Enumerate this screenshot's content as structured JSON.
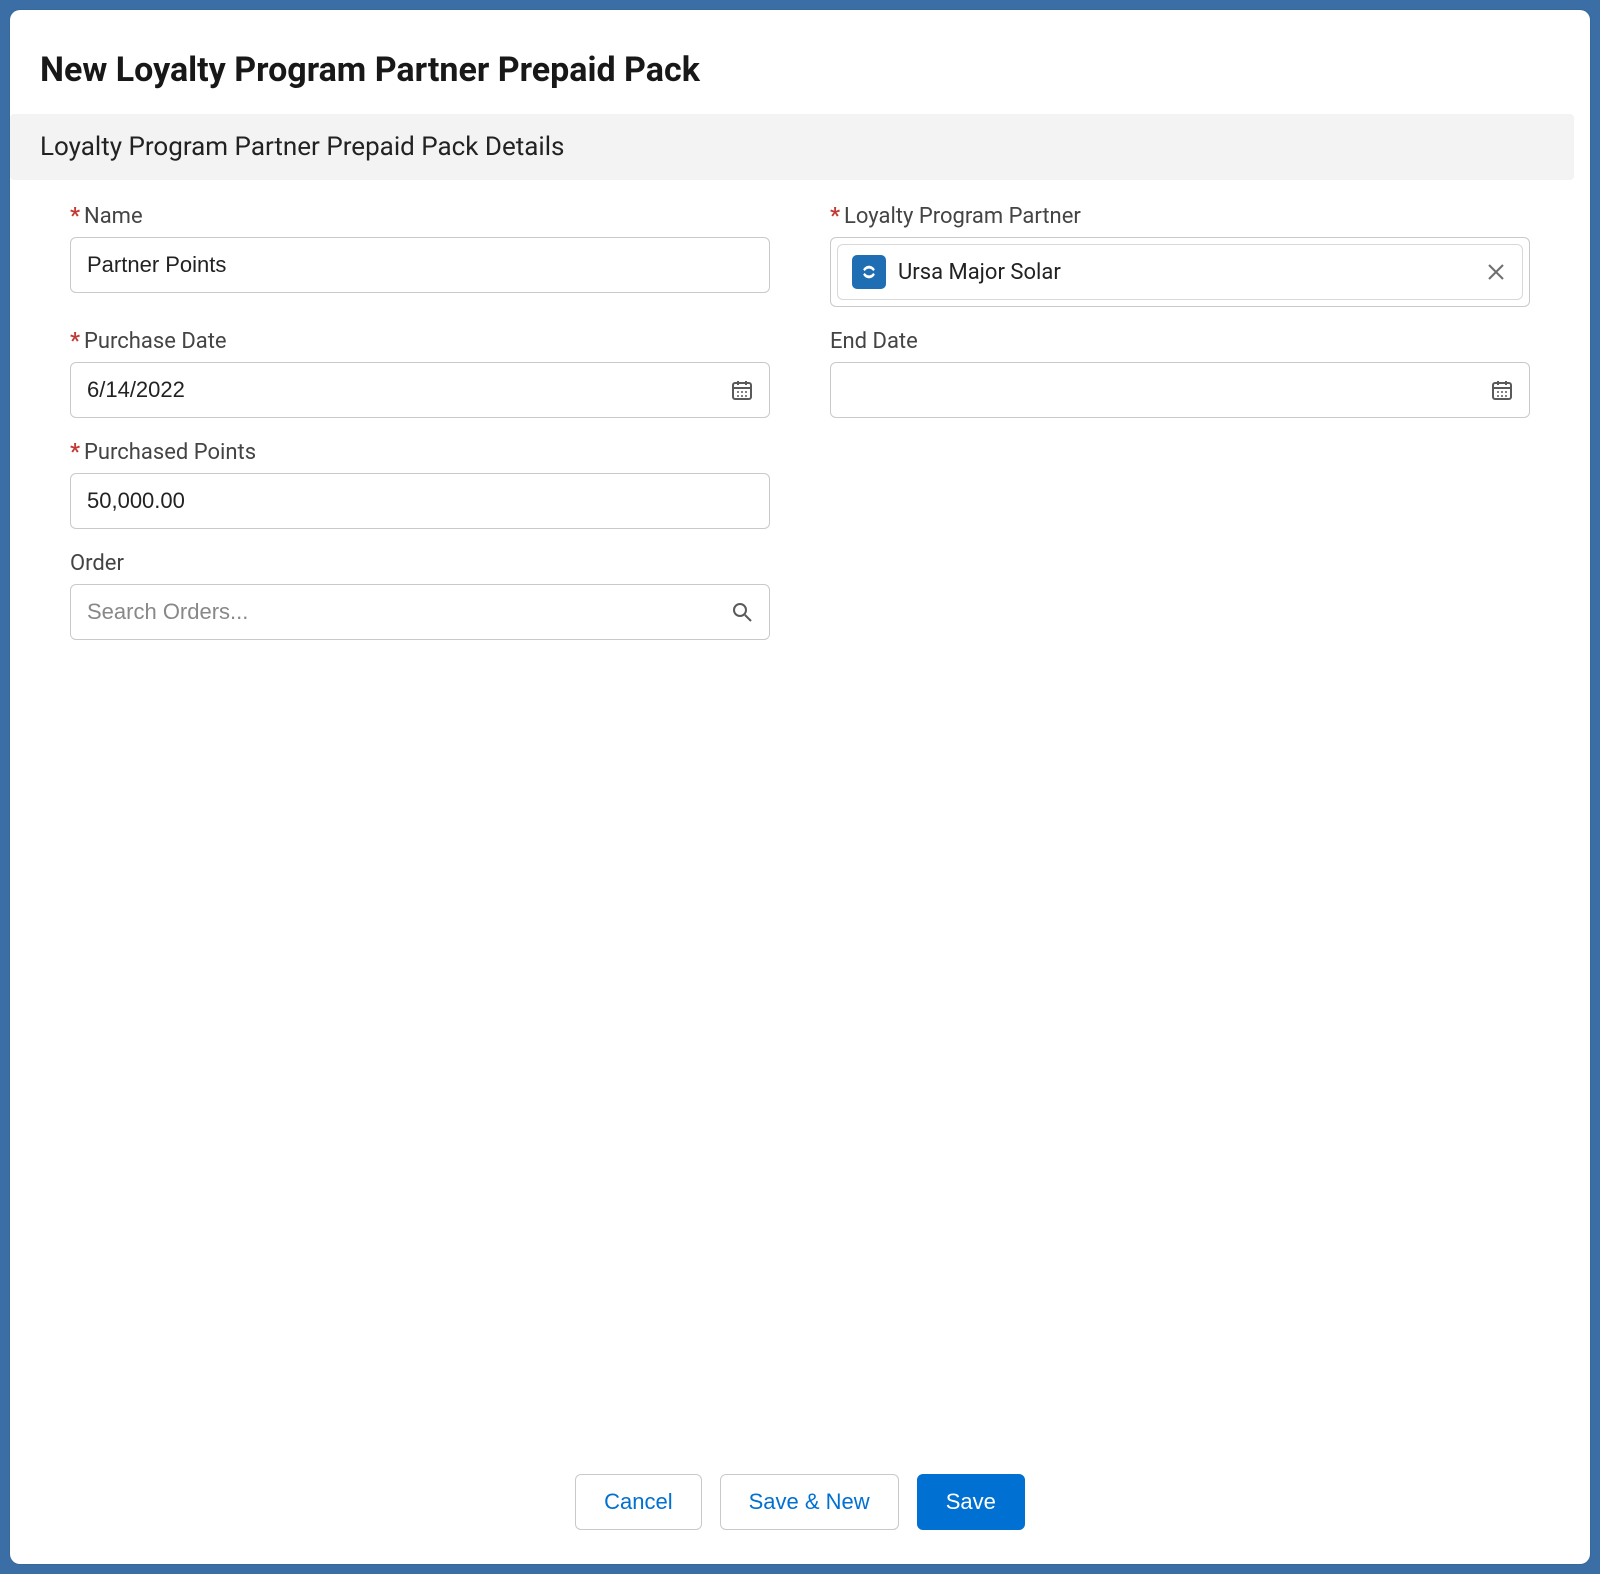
{
  "modal": {
    "title": "New Loyalty Program Partner Prepaid Pack",
    "section_title": "Loyalty Program Partner Prepaid Pack Details"
  },
  "fields": {
    "name": {
      "label": "Name",
      "value": "Partner Points",
      "required": true
    },
    "partner": {
      "label": "Loyalty Program Partner",
      "selected": "Ursa Major Solar",
      "required": true
    },
    "purchase_date": {
      "label": "Purchase Date",
      "value": "6/14/2022",
      "required": true
    },
    "end_date": {
      "label": "End Date",
      "value": "",
      "required": false
    },
    "purchased_points": {
      "label": "Purchased Points",
      "value": "50,000.00",
      "required": true
    },
    "order": {
      "label": "Order",
      "placeholder": "Search Orders...",
      "value": "",
      "required": false
    }
  },
  "footer": {
    "cancel": "Cancel",
    "save_new": "Save & New",
    "save": "Save"
  }
}
